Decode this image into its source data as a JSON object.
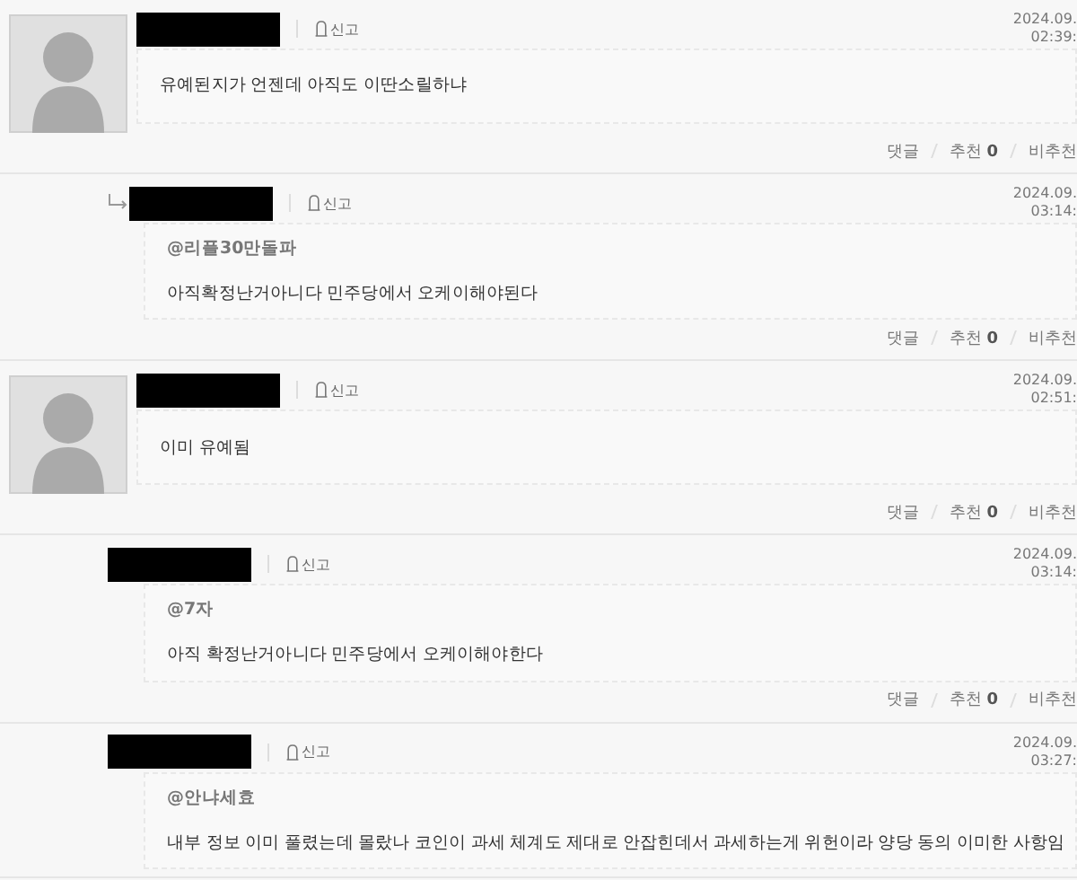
{
  "comments": [
    {
      "kind": "comment",
      "report": "신고",
      "date": "2024.09.",
      "time": "02:39:",
      "body": "유예된지가 언젠데 아직도 이딴소릴하냐",
      "actions": {
        "reply": "댓글",
        "like_label": "추천",
        "like_count": "0",
        "dislike_label": "비추천"
      }
    },
    {
      "kind": "reply",
      "reply_arrow": true,
      "report": "신고",
      "date": "2024.09.",
      "time": "03:14:",
      "mention": "@리플30만돌파",
      "body": "아직확정난거아니다 민주당에서 오케이해야된다",
      "actions": {
        "reply": "댓글",
        "like_label": "추천",
        "like_count": "0",
        "dislike_label": "비추천"
      }
    },
    {
      "kind": "comment",
      "report": "신고",
      "date": "2024.09.",
      "time": "02:51:",
      "body": "이미 유예됨",
      "actions": {
        "reply": "댓글",
        "like_label": "추천",
        "like_count": "0",
        "dislike_label": "비추천"
      }
    },
    {
      "kind": "reply",
      "reply_arrow": false,
      "report": "신고",
      "date": "2024.09.",
      "time": "03:14:",
      "mention": "@7자",
      "body": "아직 확정난거아니다 민주당에서 오케이해야한다",
      "actions": {
        "reply": "댓글",
        "like_label": "추천",
        "like_count": "0",
        "dislike_label": "비추천"
      }
    },
    {
      "kind": "reply",
      "reply_arrow": false,
      "report": "신고",
      "date": "2024.09.",
      "time": "03:27:",
      "mention": "@안냐세효",
      "body": "내부 정보 이미 풀렸는데 몰랐나 코인이 과세 체계도 제대로 안잡힌데서 과세하는게 위헌이라 양당 동의 이미한 사항임"
    }
  ]
}
